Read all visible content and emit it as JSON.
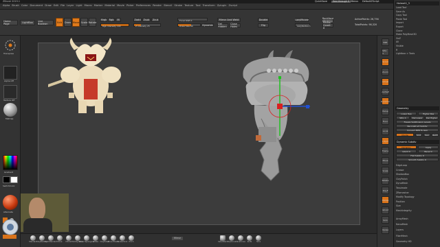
{
  "window": {
    "title": "ZBrush 2019.1",
    "quicksave": "QuickSave",
    "seethrough": "See-through 0",
    "menus_label": "Menus",
    "default_script": "DefaultZScript"
  },
  "menubar": {
    "items": [
      "Alpha",
      "Brush",
      "Color",
      "Document",
      "Draw",
      "Edit",
      "File",
      "Layer",
      "Light",
      "Macro",
      "Marker",
      "Material",
      "Movie",
      "Picker",
      "Preferences",
      "Render",
      "Stencil",
      "Stroke",
      "Texture",
      "Tool",
      "Transform",
      "Zplugin",
      "Zscript"
    ]
  },
  "toolbar": {
    "homepage": "Home Page",
    "lightbox": "LightBox",
    "live_boolean": "Live Boolean",
    "edit": "Edit",
    "draw": "Draw",
    "move": "Move",
    "scale": "Scale",
    "rotate": "Rotate",
    "mrgb": "Mrgb",
    "rgb": "Rgb",
    "m": "M",
    "zadd": "Zadd",
    "zsub": "Zsub",
    "zcut": "Zcut",
    "focal_shift": "Focal Shift 0",
    "draw_size": "Draw Size 64",
    "dynamic": "Dynamic",
    "rgb_intensity": "Rgb Intensity 100",
    "z_intensity": "Z Intensity 25",
    "mirror_weld": "Mirror And Weld",
    "del_hidden": "Del Hidden",
    "close_holes": "Close Holes",
    "double": "Double",
    "flip": "Flip",
    "lazy_mouse": "LazyMouse",
    "lazy_radius": "LazyRadius 1",
    "active_points": "ActivePoints: 26,794",
    "total_points": "TotalPoints: 98,320",
    "backface_mask": "Backface Masking",
    "radial_count": "Radial Count 8",
    "stroke_flag": "Stroke Fading",
    "gizmo_hint": "Gizmo 3D"
  },
  "leftshelf": {
    "transpose": "Transpose",
    "alpha_off": "Alpha Off",
    "texture_off": "Texture Off",
    "matcap": "MatCap",
    "gradient": "Gradient",
    "switch_color": "SwitchColor",
    "alternate": "Alternate"
  },
  "rightshelf": {
    "buttons": [
      "BPR",
      "SPix 3",
      "Scroll",
      "Zoom",
      "Actual",
      "AAHalf",
      "Dynamic",
      "Persp",
      "Floor",
      "Local",
      "L.Sym",
      "Frame",
      "Move",
      "Scale",
      "Rotate",
      "PolyF",
      "Transp",
      "Ghost",
      "Solo",
      "Xpose"
    ]
  },
  "tray": {
    "top_items": [
      "Load Tool",
      "Save As",
      "Copy Tool",
      "Paste Tool",
      "Import",
      "Export",
      "Clone",
      "Make PolyMesh3D",
      "GoZ",
      "All",
      "Visible",
      "R",
      "Lightbox > Tools"
    ],
    "tool_name": "Helmet1_3",
    "subtools": [
      "Subtool",
      "Geometry",
      "ArrayMesh",
      "NanoMesh",
      "Layers",
      "FiberMesh",
      "Geometry HD",
      "Preview",
      "Surface",
      "Deformation",
      "Masking",
      "Visibility",
      "Polygroups",
      "Contact",
      "Morph Target",
      "Polypaint",
      "UV Map",
      "Texture Map",
      "Displacement Map",
      "Normal Map",
      "Vector Displacement Map",
      "Display Properties",
      "Unified Skin",
      "Initialize",
      "Import",
      "Export"
    ],
    "geometry_section": {
      "title": "Geometry",
      "lower_res": "Lower Res",
      "higher_res": "Higher Res",
      "sdiv": "SDiv 1",
      "del_lower": "Del Lower",
      "del_higher": "Del Higher",
      "freeze": "Freeze SubDivision Levels",
      "reconstruct": "Reconstruct Subdiv",
      "convert_bpr": "Convert BPR To Geo",
      "divide": "Divide",
      "smt": "Smt",
      "suv": "Suv",
      "reluv": "ReUV"
    },
    "dynamic_subdiv": {
      "title": "Dynamic Subdiv",
      "dynamic": "Dynamic",
      "apply": "Apply",
      "qgrid": "QGrid 0",
      "bevel": "Bevel 0",
      "flat": "Flat Subdiv 0",
      "smooth": "Smooth Subdiv 0"
    },
    "lower_items": [
      "EdgeLoop",
      "Crease",
      "ShadowBox",
      "ClayPolish",
      "DynaMesh",
      "Tessimate",
      "ZRemesher",
      "Modify Topology",
      "Position",
      "Size",
      "MeshIntegrity"
    ],
    "bottom_items": [
      "ArrayMesh",
      "NanoMesh",
      "Layers",
      "FiberMesh",
      "Geometry HD"
    ]
  },
  "bottombar": {
    "brushes": [
      "Standard",
      "ClayBuildup",
      "DamStandard",
      "Move",
      "hPolish",
      "TrimDynamic",
      "Move Topological",
      "Inflate",
      "ClayTubes",
      "Move Elastic",
      "SnakeHook",
      "Pinch"
    ],
    "mirror_label": "Mirror",
    "right_tools": [
      "SelectRect",
      "ClipCurve",
      "SliceCurve",
      "Knife",
      "Slice"
    ]
  },
  "colors": {
    "accent": "#e07a1b",
    "bg": "#2b2b2b",
    "panel": "#353535",
    "canvas": "#3c3c3c"
  },
  "gizmo": {
    "x_axis": "#d92020",
    "y_axis": "#20c020",
    "z_axis": "#2050d0"
  }
}
